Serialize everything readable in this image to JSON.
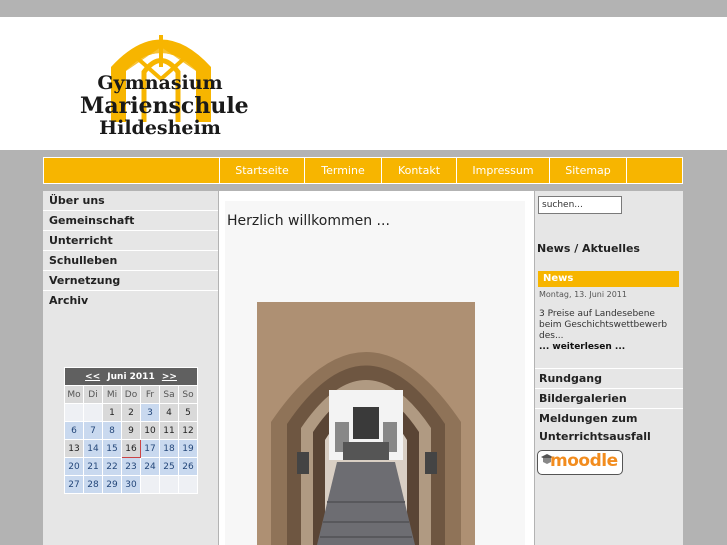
{
  "logo": {
    "line1": "Gymnasium",
    "line2": "Marienschule",
    "line3": "Hildesheim"
  },
  "nav": [
    {
      "label": "Startseite"
    },
    {
      "label": "Termine"
    },
    {
      "label": "Kontakt"
    },
    {
      "label": "Impressum"
    },
    {
      "label": "Sitemap"
    }
  ],
  "sidebar": {
    "items": [
      {
        "label": "Über uns"
      },
      {
        "label": "Gemeinschaft"
      },
      {
        "label": "Unterricht"
      },
      {
        "label": "Schulleben"
      },
      {
        "label": "Vernetzung"
      },
      {
        "label": "Archiv"
      }
    ]
  },
  "calendar": {
    "prev": "<<",
    "title": "Juni 2011",
    "next": ">>",
    "weekdays": [
      "Mo",
      "Di",
      "Mi",
      "Do",
      "Fr",
      "Sa",
      "So"
    ],
    "rows": [
      [
        "",
        "",
        "1",
        "2",
        "3",
        "4",
        "5"
      ],
      [
        "6",
        "7",
        "8",
        "9",
        "10",
        "11",
        "12"
      ],
      [
        "13",
        "14",
        "15",
        "16",
        "17",
        "18",
        "19"
      ],
      [
        "20",
        "21",
        "22",
        "23",
        "24",
        "25",
        "26"
      ],
      [
        "27",
        "28",
        "29",
        "30",
        "",
        "",
        ""
      ]
    ]
  },
  "main": {
    "title": "Herzlich willkommen ..."
  },
  "search": {
    "placeholder": "suchen..."
  },
  "news": {
    "section_title": "News / Aktuelles",
    "bar_label": "News",
    "date": "Montag, 13. Juni 2011",
    "text": "3 Preise auf Landesebene beim Geschichtswettbewerb des...",
    "more": "... weiterlesen ..."
  },
  "right_links": [
    {
      "label": "Rundgang"
    },
    {
      "label": "Bildergalerien"
    },
    {
      "label": "Meldungen zum"
    }
  ],
  "right_link_cont": "Unterrichtsausfall",
  "moodle": {
    "label": "moodle"
  },
  "colors": {
    "accent": "#f7b500",
    "background": "#b3b3b3",
    "panel": "#e6e6e6"
  }
}
